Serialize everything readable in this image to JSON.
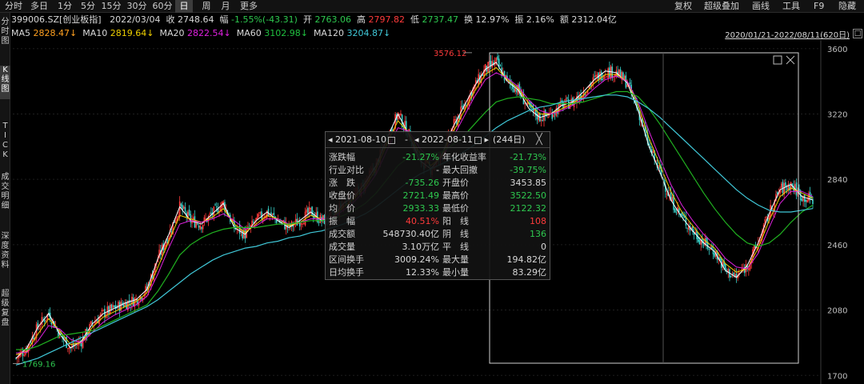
{
  "toolbar": {
    "left": [
      "分时",
      "多日",
      "1分",
      "5分",
      "15分",
      "30分",
      "60分",
      "日",
      "周",
      "月",
      "更多"
    ],
    "active": "日",
    "right": [
      "复权",
      "超级叠加",
      "画线",
      "工具",
      "F9",
      "隐藏"
    ]
  },
  "quote": {
    "code": "399006.SZ[创业板指]",
    "date": "2022/03/04",
    "close_label": "收",
    "close": "2748.64",
    "chg_label": "幅",
    "chg": "-1.55%(-43.31)",
    "open_label": "开",
    "open": "2763.06",
    "high_label": "高",
    "high": "2797.82",
    "low_label": "低",
    "low": "2737.47",
    "turnover_label": "换",
    "turnover": "12.97%",
    "amp_label": "振",
    "amp": "2.16%",
    "amount_label": "额",
    "amount": "2312.04亿"
  },
  "ma": {
    "ma5_label": "MA5",
    "ma5": "2828.47↓",
    "ma10_label": "MA10",
    "ma10": "2819.64↓",
    "ma20_label": "MA20",
    "ma20": "2822.54↓",
    "ma60_label": "MA60",
    "ma60": "3102.98↓",
    "ma120_label": "MA120",
    "ma120": "3204.87↓"
  },
  "range_label": "2020/01/21-2022/08/11(620日)",
  "range_btn": "□",
  "side_tabs": [
    "分\n时\n图",
    "K\n线\n图",
    "T\nI\nC\nK",
    "成\n交\n明\n细",
    "深\n度\n资\n料",
    "超\n级\n复\n盘"
  ],
  "stats": {
    "start": "2021-08-10",
    "dash": "-",
    "end": "2022-08-11",
    "days": "(244日)",
    "close_x": "╳",
    "rows": [
      {
        "l1": "涨跌幅",
        "v1": "-21.27%",
        "c1": "g",
        "l2": "年化收益率",
        "v2": "-21.73%",
        "c2": "g"
      },
      {
        "l1": "行业对比",
        "v1": "-",
        "c1": "w",
        "l2": "最大回撤",
        "v2": "-39.75%",
        "c2": "g"
      },
      {
        "l1": "涨　跌",
        "v1": "-735.26",
        "c1": "g",
        "l2": "开盘价",
        "v2": "3453.85",
        "c2": "w"
      },
      {
        "l1": "收盘价",
        "v1": "2721.49",
        "c1": "g",
        "l2": "最高价",
        "v2": "3522.50",
        "c2": "g"
      },
      {
        "l1": "均　价",
        "v1": "2933.33",
        "c1": "g",
        "l2": "最低价",
        "v2": "2122.32",
        "c2": "g"
      },
      {
        "l1": "振　幅",
        "v1": "40.51%",
        "c1": "r",
        "l2": "阳　线",
        "v2": "108",
        "c2": "r"
      },
      {
        "l1": "成交额",
        "v1": "548730.40亿",
        "c1": "w",
        "l2": "阴　线",
        "v2": "136",
        "c2": "g"
      },
      {
        "l1": "成交量",
        "v1": "3.10万亿",
        "c1": "w",
        "l2": "平　线",
        "v2": "0",
        "c2": "w"
      },
      {
        "l1": "区间换手",
        "v1": "3009.24%",
        "c1": "w",
        "l2": "最大量",
        "v2": "194.82亿",
        "c2": "w"
      },
      {
        "l1": "日均换手",
        "v1": "12.33%",
        "c1": "w",
        "l2": "最小量",
        "v2": "83.29亿",
        "c2": "w"
      }
    ]
  },
  "colors": {
    "up": "#ff3b3b",
    "down": "#2ec84f",
    "ma5": "#ffffff",
    "ma10": "#f0d000",
    "ma20": "#e020e0",
    "ma60": "#20b020",
    "ma120": "#40c8d8"
  },
  "chart_data": {
    "type": "line",
    "title": "",
    "xlabel": "",
    "ylabel": "",
    "ylim": [
      1650,
      3650
    ],
    "y_ticks": [
      "3600",
      "3220",
      "2840",
      "2460",
      "2080",
      "1700"
    ],
    "x_range": [
      "2020/01/21",
      "2022/08/11"
    ],
    "annotations": [
      {
        "text": "3576.12",
        "x": "2021-12",
        "y": 3576.12
      },
      {
        "text": "1769.16",
        "x": "2020-01",
        "y": 1769.16
      }
    ],
    "series": [
      {
        "name": "MA5",
        "values": [
          1800,
          1860,
          1980,
          2060,
          1940,
          1860,
          1900,
          2000,
          2060,
          2090,
          2120,
          2140,
          2200,
          2380,
          2520,
          2680,
          2600,
          2580,
          2640,
          2700,
          2560,
          2520,
          2600,
          2650,
          2600,
          2560,
          2600,
          2650,
          2600,
          2620,
          2700,
          2740,
          2820,
          2920,
          3080,
          3220,
          3100,
          2950,
          2900,
          2980,
          3140,
          3260,
          3380,
          3480,
          3520,
          3410,
          3360,
          3250,
          3200,
          3220,
          3270,
          3290,
          3350,
          3420,
          3470,
          3460,
          3400,
          3240,
          3030,
          2880,
          2720,
          2620,
          2540,
          2470,
          2420,
          2310,
          2270,
          2340,
          2470,
          2640,
          2780,
          2810,
          2740,
          2720
        ]
      },
      {
        "name": "MA10",
        "values": [
          1820,
          1840,
          1940,
          2030,
          1960,
          1880,
          1890,
          1980,
          2040,
          2070,
          2100,
          2130,
          2180,
          2330,
          2480,
          2630,
          2610,
          2590,
          2620,
          2670,
          2580,
          2530,
          2580,
          2630,
          2610,
          2570,
          2590,
          2630,
          2610,
          2620,
          2680,
          2730,
          2800,
          2900,
          3050,
          3180,
          3110,
          2990,
          2920,
          2970,
          3110,
          3230,
          3350,
          3450,
          3490,
          3420,
          3370,
          3280,
          3220,
          3220,
          3250,
          3280,
          3330,
          3400,
          3450,
          3450,
          3410,
          3270,
          3080,
          2920,
          2770,
          2650,
          2570,
          2490,
          2440,
          2350,
          2300,
          2320,
          2440,
          2600,
          2740,
          2790,
          2760,
          2730
        ]
      },
      {
        "name": "MA20",
        "values": [
          1830,
          1835,
          1900,
          1990,
          1970,
          1910,
          1890,
          1950,
          2010,
          2050,
          2080,
          2110,
          2160,
          2290,
          2440,
          2580,
          2600,
          2590,
          2610,
          2640,
          2600,
          2550,
          2570,
          2610,
          2610,
          2580,
          2590,
          2610,
          2610,
          2620,
          2660,
          2710,
          2780,
          2870,
          3010,
          3140,
          3120,
          3020,
          2950,
          2960,
          3080,
          3200,
          3320,
          3420,
          3460,
          3430,
          3380,
          3300,
          3240,
          3220,
          3240,
          3270,
          3310,
          3370,
          3420,
          3440,
          3410,
          3290,
          3120,
          2960,
          2810,
          2690,
          2600,
          2520,
          2460,
          2380,
          2330,
          2320,
          2410,
          2560,
          2700,
          2770,
          2770,
          2740
        ]
      },
      {
        "name": "MA60",
        "values": [
          1850,
          1850,
          1870,
          1900,
          1930,
          1940,
          1950,
          1960,
          1990,
          2020,
          2050,
          2080,
          2110,
          2190,
          2290,
          2400,
          2460,
          2500,
          2530,
          2550,
          2560,
          2560,
          2560,
          2570,
          2580,
          2580,
          2590,
          2600,
          2600,
          2610,
          2630,
          2660,
          2700,
          2760,
          2840,
          2920,
          2970,
          2990,
          2990,
          3000,
          3040,
          3090,
          3160,
          3230,
          3290,
          3310,
          3320,
          3310,
          3300,
          3280,
          3280,
          3280,
          3290,
          3310,
          3330,
          3350,
          3350,
          3320,
          3250,
          3160,
          3060,
          2960,
          2860,
          2760,
          2670,
          2590,
          2520,
          2470,
          2450,
          2470,
          2520,
          2590,
          2650,
          2690
        ]
      },
      {
        "name": "MA120",
        "values": [
          1760,
          1780,
          1800,
          1830,
          1860,
          1890,
          1920,
          1950,
          1980,
          2010,
          2040,
          2070,
          2100,
          2140,
          2190,
          2240,
          2290,
          2330,
          2370,
          2400,
          2420,
          2440,
          2450,
          2470,
          2480,
          2500,
          2510,
          2530,
          2540,
          2560,
          2580,
          2610,
          2640,
          2680,
          2730,
          2780,
          2830,
          2870,
          2900,
          2930,
          2960,
          3000,
          3040,
          3090,
          3140,
          3180,
          3210,
          3240,
          3260,
          3270,
          3290,
          3300,
          3310,
          3320,
          3330,
          3330,
          3320,
          3290,
          3250,
          3200,
          3140,
          3080,
          3020,
          2960,
          2900,
          2840,
          2780,
          2730,
          2690,
          2660,
          2650,
          2650,
          2660,
          2670
        ]
      }
    ]
  }
}
